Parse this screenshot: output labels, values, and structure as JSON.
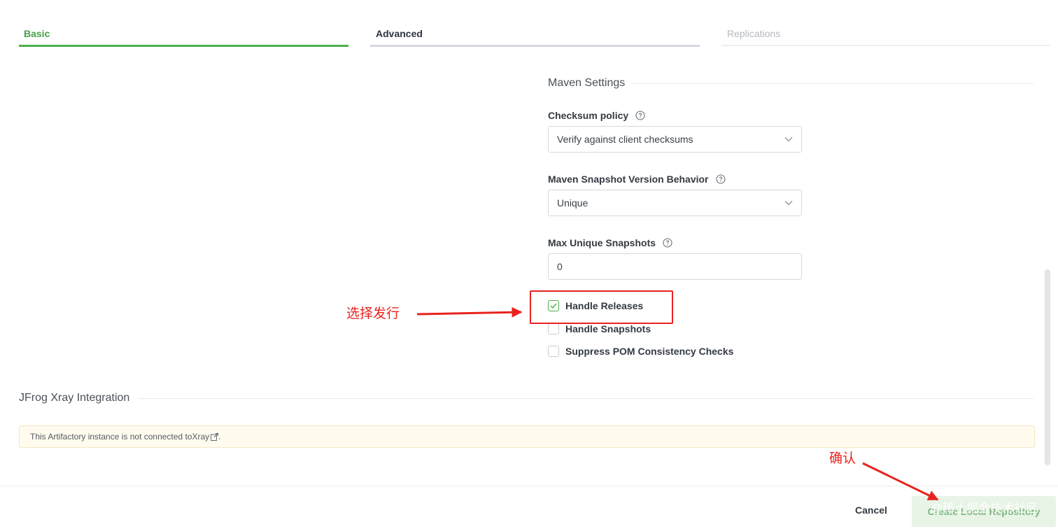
{
  "tabs": [
    {
      "label": "Basic"
    },
    {
      "label": "Advanced"
    },
    {
      "label": "Replications"
    }
  ],
  "maven": {
    "section_title": "Maven Settings",
    "checksum": {
      "label": "Checksum policy",
      "value": "Verify against client checksums"
    },
    "snapshot_behavior": {
      "label": "Maven Snapshot Version Behavior",
      "value": "Unique"
    },
    "max_snapshots": {
      "label": "Max Unique Snapshots",
      "value": "0"
    },
    "checkboxes": [
      {
        "label": "Handle Releases",
        "checked": true
      },
      {
        "label": "Handle Snapshots",
        "checked": false
      },
      {
        "label": "Suppress POM Consistency Checks",
        "checked": false
      }
    ]
  },
  "xray": {
    "section_title": "JFrog Xray Integration",
    "notice_prefix": "This Artifactory instance is not connected to ",
    "notice_link": "Xray",
    "notice_suffix": "."
  },
  "annotations": {
    "select_release": "选择发行",
    "confirm": "确认"
  },
  "footer": {
    "cancel_label": "Cancel",
    "create_label": "Create Local Repository"
  },
  "watermark": "@稀土掘金技术社区",
  "icons": [
    "help-icon",
    "chevron-down-icon",
    "checkmark-icon",
    "external-link-icon"
  ],
  "colors": {
    "accent": "#4cb04c",
    "annotation": "#e8231f",
    "notice_bg": "#fffbef"
  }
}
